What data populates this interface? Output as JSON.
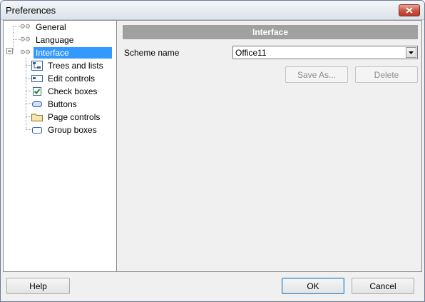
{
  "window": {
    "title": "Preferences"
  },
  "tree": {
    "items": [
      {
        "label": "General",
        "icon": "gears-icon",
        "selected": false
      },
      {
        "label": "Language",
        "icon": "gears-icon",
        "selected": false
      },
      {
        "label": "Interface",
        "icon": "gears-icon",
        "selected": true,
        "expanded": true
      },
      {
        "label": "Trees and lists",
        "icon": "tree-icon",
        "selected": false
      },
      {
        "label": "Edit controls",
        "icon": "edit-icon",
        "selected": false
      },
      {
        "label": "Check boxes",
        "icon": "checkbox-icon",
        "selected": false
      },
      {
        "label": "Buttons",
        "icon": "button-icon",
        "selected": false
      },
      {
        "label": "Page controls",
        "icon": "folder-icon",
        "selected": false
      },
      {
        "label": "Group boxes",
        "icon": "groupbox-icon",
        "selected": false
      }
    ]
  },
  "pane": {
    "header": "Interface",
    "scheme_label": "Scheme name",
    "scheme_value": "Office11",
    "save_as_label": "Save As...",
    "delete_label": "Delete"
  },
  "footer": {
    "help_label": "Help",
    "ok_label": "OK",
    "cancel_label": "Cancel"
  },
  "colors": {
    "selection": "#3399ff",
    "header_bg": "#a0a0a0"
  }
}
